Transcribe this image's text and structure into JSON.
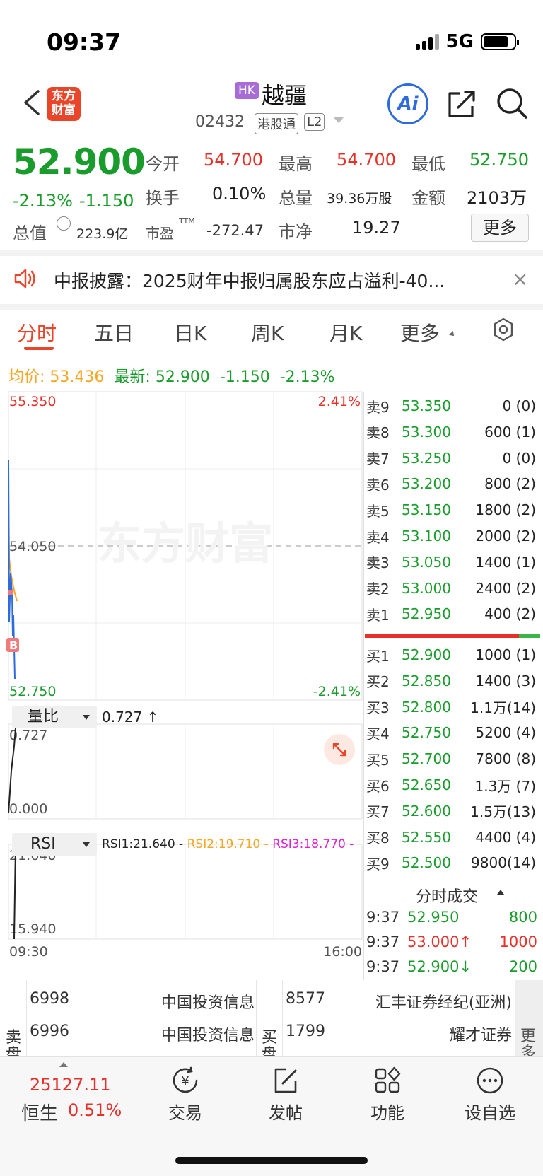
{
  "status_bar": {
    "time": "09:37",
    "network": "5G"
  },
  "header": {
    "logo_line1": "东方",
    "logo_line2": "财富",
    "market_badge": "HK",
    "stock_name": "越疆",
    "stock_code": "02432",
    "connect_tag": "港股通",
    "level_tag": "L2",
    "ai_label": "Ai"
  },
  "quote": {
    "last_price": "52.900",
    "change_pct": "-2.13%",
    "change_abs": "-1.150",
    "open_label": "今开",
    "open_value": "54.700",
    "high_label": "最高",
    "high_value": "54.700",
    "low_label": "最低",
    "low_value": "52.750",
    "turnover_label": "换手",
    "turnover_value": "0.10%",
    "volume_label": "总量",
    "volume_value": "39.36万股",
    "amount_label": "金额",
    "amount_value": "2103万",
    "mktcap_label": "总值",
    "mktcap_value": "223.9亿",
    "pe_label": "市盈",
    "pe_sup": "TTM",
    "pe_value": "-272.47",
    "pb_label": "市净",
    "pb_value": "19.27",
    "more_label": "更多"
  },
  "notice": {
    "text": "中报披露：2025财年中报归属股东应占溢利-40...",
    "close": "×"
  },
  "tabs": [
    {
      "label": "分时"
    },
    {
      "label": "五日"
    },
    {
      "label": "日K"
    },
    {
      "label": "周K"
    },
    {
      "label": "月K"
    },
    {
      "label": "更多"
    }
  ],
  "intraday": {
    "avg_label": "均价:",
    "avg_value": "53.436",
    "latest_label": "最新:",
    "latest_value": "52.900",
    "latest_change": "-1.150",
    "latest_pct": "-2.13%",
    "y_top": "55.350",
    "y_mid": "54.050",
    "y_bottom": "52.750",
    "pct_top": "2.41%",
    "pct_bottom": "-2.41%",
    "marker": "B",
    "watermark": "东方财富",
    "time_start": "09:30",
    "time_end": "16:00"
  },
  "indicator1": {
    "name": "量比",
    "value": "0.727 ↑",
    "y_top": "0.727",
    "y_bottom": "0.000"
  },
  "indicator2": {
    "name": "RSI",
    "rsi1": "RSI1:21.640 -",
    "rsi2": "RSI2:19.710 -",
    "rsi3": "RSI3:18.770 -",
    "y_top": "21.640",
    "y_bottom": "15.940"
  },
  "order_book": {
    "asks": [
      {
        "label": "卖9",
        "price": "53.350",
        "volume": "0 (0)"
      },
      {
        "label": "卖8",
        "price": "53.300",
        "volume": "600 (1)"
      },
      {
        "label": "卖7",
        "price": "53.250",
        "volume": "0 (0)"
      },
      {
        "label": "卖6",
        "price": "53.200",
        "volume": "800 (2)"
      },
      {
        "label": "卖5",
        "price": "53.150",
        "volume": "1800 (2)"
      },
      {
        "label": "卖4",
        "price": "53.100",
        "volume": "2000 (2)"
      },
      {
        "label": "卖3",
        "price": "53.050",
        "volume": "1400 (1)"
      },
      {
        "label": "卖2",
        "price": "53.000",
        "volume": "2400 (2)"
      },
      {
        "label": "卖1",
        "price": "52.950",
        "volume": "400 (2)"
      }
    ],
    "bids": [
      {
        "label": "买1",
        "price": "52.900",
        "volume": "1000 (1)"
      },
      {
        "label": "买2",
        "price": "52.850",
        "volume": "1400 (3)"
      },
      {
        "label": "买3",
        "price": "52.800",
        "volume": "1.1万(14)"
      },
      {
        "label": "买4",
        "price": "52.750",
        "volume": "5200 (4)"
      },
      {
        "label": "买5",
        "price": "52.700",
        "volume": "7800 (8)"
      },
      {
        "label": "买6",
        "price": "52.650",
        "volume": "1.3万 (7)"
      },
      {
        "label": "买7",
        "price": "52.600",
        "volume": "1.5万(13)"
      },
      {
        "label": "买8",
        "price": "52.550",
        "volume": "4400 (4)"
      },
      {
        "label": "买9",
        "price": "52.500",
        "volume": "9800(14)"
      }
    ]
  },
  "trades": {
    "title": "分时成交",
    "rows": [
      {
        "time": "9:37",
        "price": "52.950",
        "volume": "800",
        "dir": "green"
      },
      {
        "time": "9:37",
        "price": "53.000↑",
        "volume": "1000",
        "dir": "red"
      },
      {
        "time": "9:37",
        "price": "52.900↓",
        "volume": "200",
        "dir": "green"
      }
    ]
  },
  "broker_queue": {
    "sell_label": "卖盘",
    "buy_label": "买盘",
    "more_label": "更多",
    "sell": [
      {
        "code": "6998",
        "name": "中国投资信息"
      },
      {
        "code": "6996",
        "name": "中国投资信息"
      }
    ],
    "buy": [
      {
        "code": "8577",
        "name": "汇丰证券经纪(亚洲)"
      },
      {
        "code": "1799",
        "name": "耀才证券"
      }
    ]
  },
  "bottom_nav": {
    "index_value": "25127.11",
    "index_name": "恒生",
    "index_pct": "0.51%",
    "items": [
      {
        "label": "交易"
      },
      {
        "label": "发帖"
      },
      {
        "label": "功能"
      },
      {
        "label": "设自选"
      }
    ]
  },
  "colors": {
    "up": "#e8302a",
    "down": "#1a9c2c",
    "accent": "#e8452a",
    "avg_line": "#f5a623",
    "price_line": "#2e6bdc"
  }
}
